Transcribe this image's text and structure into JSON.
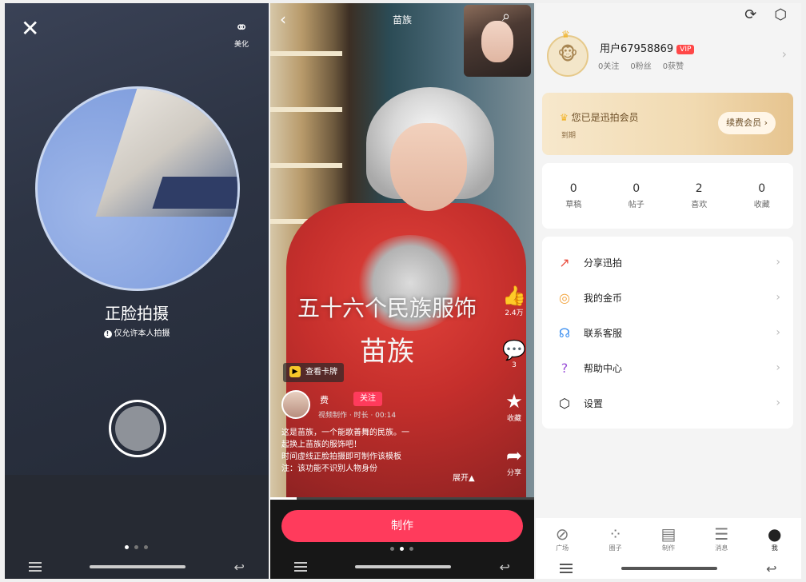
{
  "panel1": {
    "close_icon": "close-icon",
    "beauty_label": "美化",
    "title": "正脸拍摄",
    "hint": "仅允许本人拍摄",
    "page_dots": [
      true,
      false,
      false
    ]
  },
  "panel2": {
    "top_title": "苗族",
    "overlay_line1": "五十六个民族服饰",
    "overlay_line2": "苗族",
    "actions": [
      {
        "icon": "thumbs-up-icon",
        "label": "2.4万"
      },
      {
        "icon": "comment-icon",
        "label": "3"
      },
      {
        "icon": "star-icon",
        "label": "收藏"
      },
      {
        "icon": "share-icon",
        "label": "分享"
      }
    ],
    "tag": "查看卡牌",
    "username": "费",
    "follow": "关注",
    "meta": "视频制作 · 时长 · 00:14",
    "desc": [
      "这是苗族，一个能歌善舞的民族。一",
      "起换上苗族的服饰吧！",
      "时间虚线正脸拍摄即可制作该模板",
      "注：该功能不识别人物身份"
    ],
    "expand": "展开",
    "make_button": "制作",
    "page_dots": [
      false,
      true,
      false
    ]
  },
  "panel3": {
    "username": "用户67958869",
    "vip": "VIP",
    "stats_small": [
      "0关注",
      "0粉丝",
      "0获赞"
    ],
    "member_title": "您已是迅拍会员",
    "member_sub": "到期",
    "member_button": "续费会员",
    "counts": [
      {
        "n": "0",
        "l": "草稿"
      },
      {
        "n": "0",
        "l": "帖子"
      },
      {
        "n": "2",
        "l": "喜欢"
      },
      {
        "n": "0",
        "l": "收藏"
      }
    ],
    "menu": [
      {
        "icon": "share-icon",
        "label": "分享迅拍",
        "color": "#e94b3c"
      },
      {
        "icon": "coin-icon",
        "label": "我的金币",
        "color": "#f2a23a"
      },
      {
        "icon": "headset-icon",
        "label": "联系客服",
        "color": "#3a8ef0"
      },
      {
        "icon": "help-icon",
        "label": "帮助中心",
        "color": "#9a4fd8"
      },
      {
        "icon": "settings-icon",
        "label": "设置",
        "color": "#222222"
      }
    ],
    "tabs": [
      {
        "icon": "compass-icon",
        "label": "广场"
      },
      {
        "icon": "grid-icon",
        "label": "圈子"
      },
      {
        "icon": "clapper-icon",
        "label": "制作"
      },
      {
        "icon": "message-icon",
        "label": "消息"
      },
      {
        "icon": "user-icon",
        "label": "我"
      }
    ]
  }
}
